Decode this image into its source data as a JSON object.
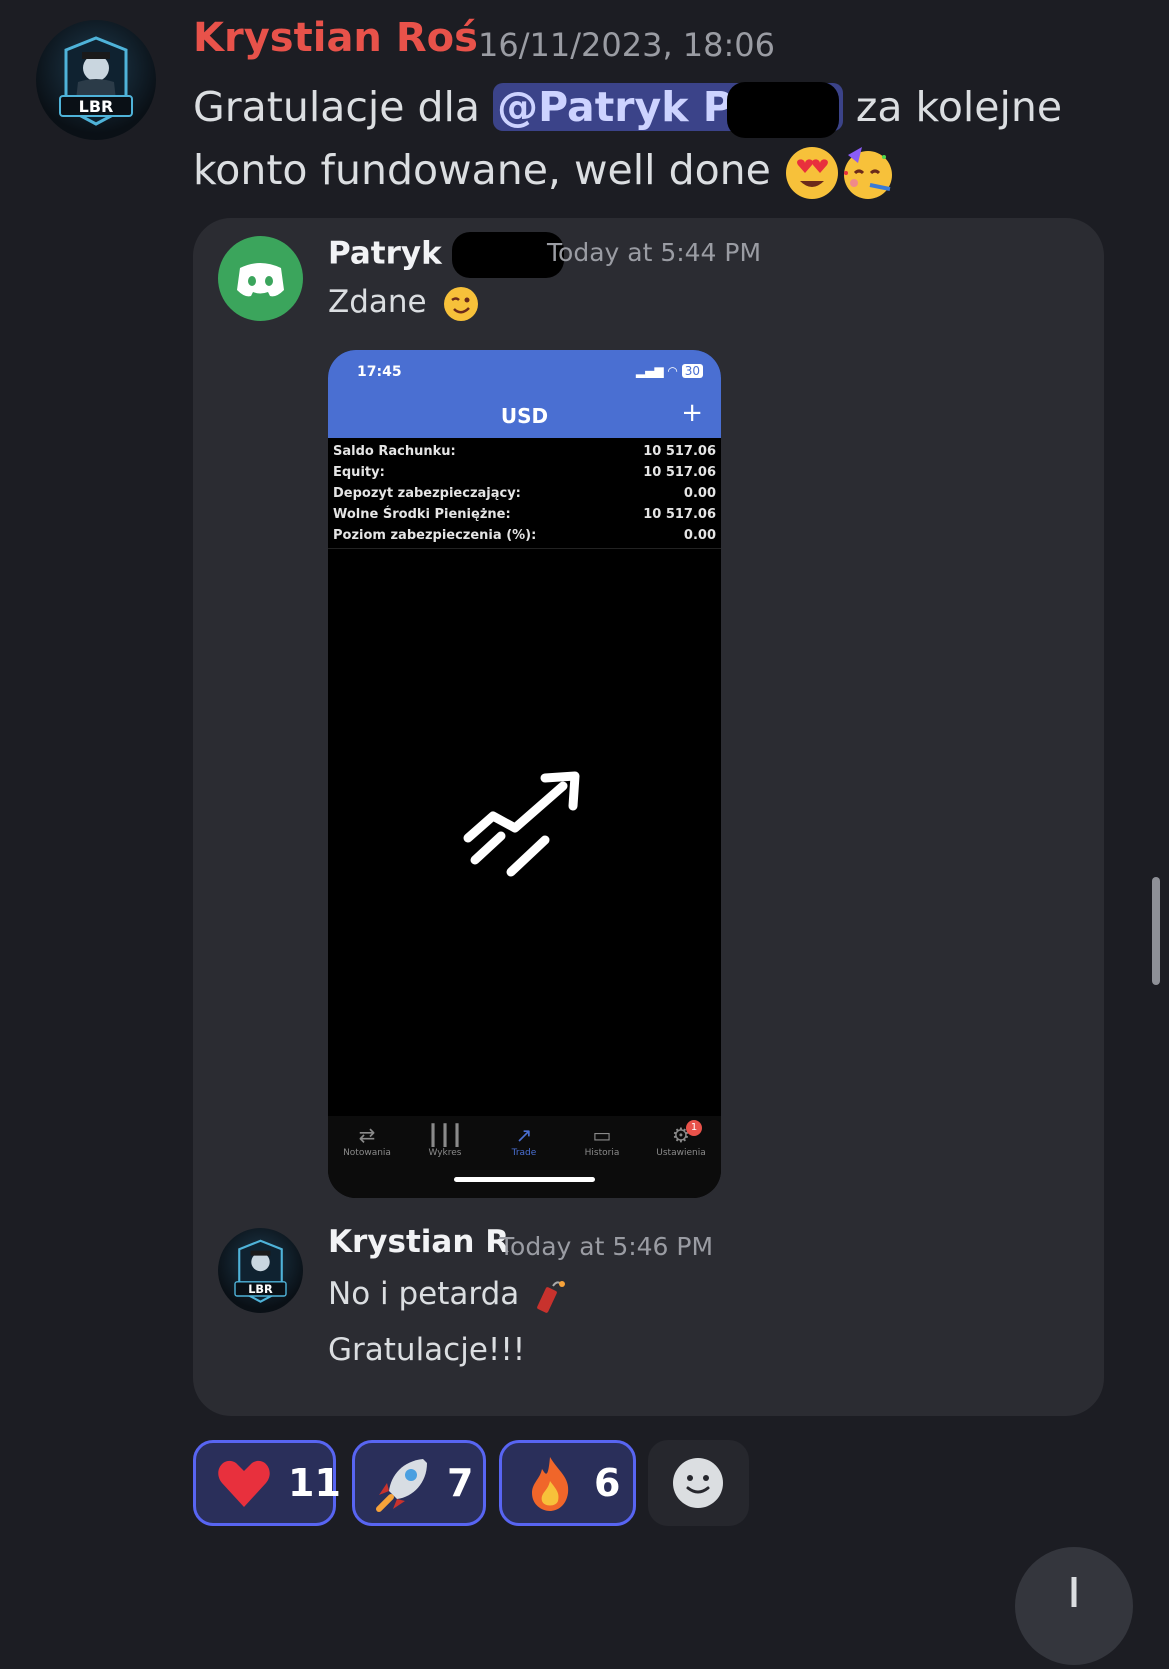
{
  "message": {
    "author": "Krystian Roś",
    "timestamp": "16/11/2023, 18:06",
    "text_before": "Gratulacje dla ",
    "mention": "@Patryk P",
    "text_after": " za kolejne konto fundowane, well done"
  },
  "embed": {
    "author": "Patryk",
    "time": "Today at 5:44 PM",
    "text": "Zdane",
    "phone": {
      "clock": "17:45",
      "battery": "30",
      "title": "USD",
      "plus": "+",
      "rows": [
        {
          "label": "Saldo Rachunku:",
          "value": "10 517.06"
        },
        {
          "label": "Equity:",
          "value": "10 517.06"
        },
        {
          "label": "Depozyt zabezpieczający:",
          "value": "0.00"
        },
        {
          "label": "Wolne Środki Pieniężne:",
          "value": "10 517.06"
        },
        {
          "label": "Poziom zabezpieczenia (%):",
          "value": "0.00"
        }
      ],
      "tabs": [
        "Notowania",
        "Wykres",
        "Trade",
        "Historia",
        "Ustawienia"
      ],
      "badge": "1"
    },
    "reply": {
      "author": "Krystian R",
      "time": "Today at 5:46 PM",
      "line1": "No i petarda",
      "line2": "Gratulacje!!!"
    }
  },
  "reactions": [
    {
      "emoji": "heart",
      "count": "11"
    },
    {
      "emoji": "rocket",
      "count": "7"
    },
    {
      "emoji": "fire",
      "count": "6"
    }
  ],
  "avatar_text": "LBR",
  "colors": {
    "accent": "#5865f2",
    "author": "#e8524a",
    "phone_header": "#4a6fd2"
  }
}
